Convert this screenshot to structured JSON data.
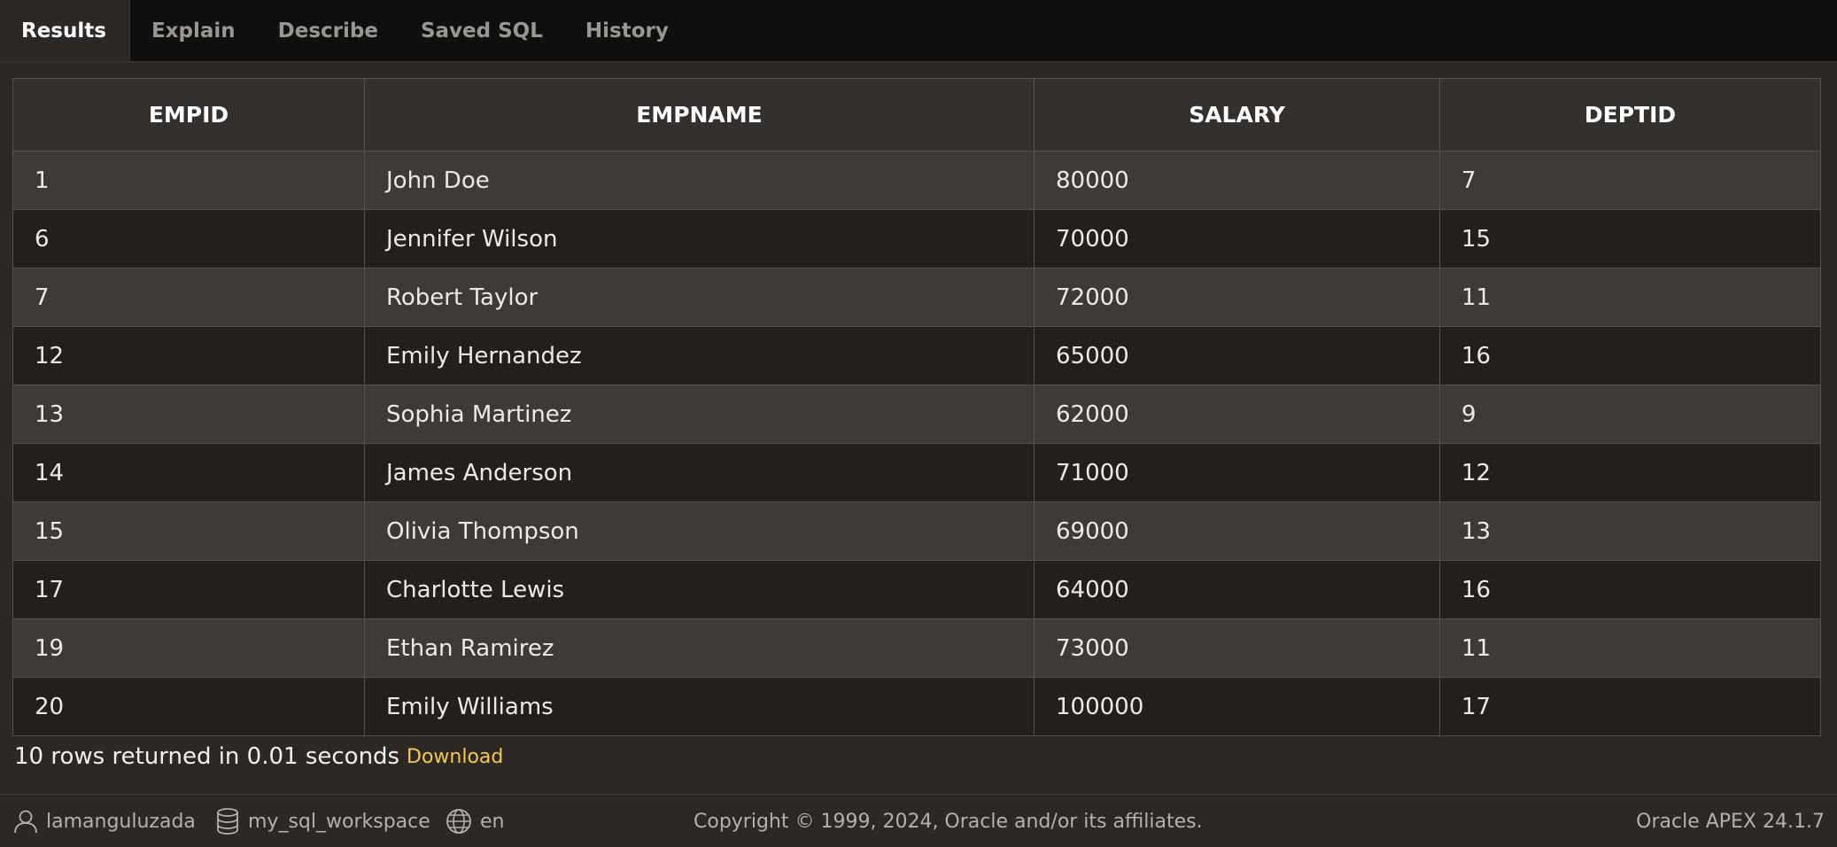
{
  "tabs": [
    {
      "label": "Results",
      "active": true
    },
    {
      "label": "Explain",
      "active": false
    },
    {
      "label": "Describe",
      "active": false
    },
    {
      "label": "Saved SQL",
      "active": false
    },
    {
      "label": "History",
      "active": false
    }
  ],
  "results": {
    "columns": [
      "EMPID",
      "EMPNAME",
      "SALARY",
      "DEPTID"
    ],
    "rows": [
      [
        "1",
        "John Doe",
        "80000",
        "7"
      ],
      [
        "6",
        "Jennifer Wilson",
        "70000",
        "15"
      ],
      [
        "7",
        "Robert Taylor",
        "72000",
        "11"
      ],
      [
        "12",
        "Emily Hernandez",
        "65000",
        "16"
      ],
      [
        "13",
        "Sophia Martinez",
        "62000",
        "9"
      ],
      [
        "14",
        "James Anderson",
        "71000",
        "12"
      ],
      [
        "15",
        "Olivia Thompson",
        "69000",
        "13"
      ],
      [
        "17",
        "Charlotte Lewis",
        "64000",
        "16"
      ],
      [
        "19",
        "Ethan Ramirez",
        "73000",
        "11"
      ],
      [
        "20",
        "Emily Williams",
        "100000",
        "17"
      ]
    ],
    "summary": "10 rows returned in 0.01 seconds",
    "download_label": "Download"
  },
  "footer": {
    "user": "lamanguluzada",
    "workspace": "my_sql_workspace",
    "language": "en",
    "copyright": "Copyright © 1999, 2024, Oracle and/or its affiliates.",
    "version": "Oracle APEX 24.1.7"
  },
  "colors": {
    "accent_link": "#f6c94a",
    "tabbar_bg": "#100f0d",
    "page_bg": "#2b2826"
  },
  "icons": {
    "user": "user-icon",
    "workspace": "database-icon",
    "language": "globe-icon"
  }
}
